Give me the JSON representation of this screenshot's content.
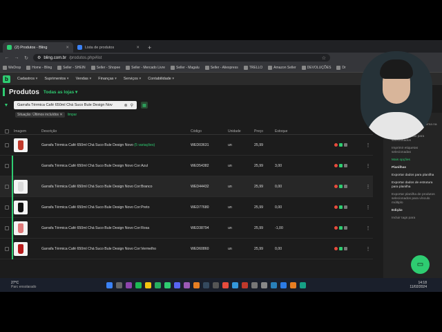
{
  "browser": {
    "tabs": [
      {
        "label": "(2) Produtos - Bling",
        "active": true
      },
      {
        "label": "Lista de produtos",
        "active": false
      }
    ],
    "url_host": "bling.com.br",
    "url_path": "/produtos.php#list",
    "bookmarks": [
      "WeDrop",
      "Home - Bling",
      "Seller - SHEIN",
      "Seller - Shopee",
      "Seller - Mercado Livre",
      "Seller - Magalu",
      "Seller - Aliexpress",
      "TRELLO",
      "Amazon Seller",
      "DEVOLUÇÕES",
      "Dr"
    ]
  },
  "app": {
    "logo": "b",
    "menu": [
      "Cadastros",
      "Suprimentos",
      "Vendas",
      "Finanças",
      "Serviços",
      "Contabilidade"
    ],
    "page_title": "Produtos",
    "store_select": "Todas as lojas ▾",
    "search_value": "Garrafa Térmica Café 650ml Chá Suco Bule Design Nov",
    "filter_chip": "Situação: Últimos incluídos ✕",
    "clear_label": "limpar"
  },
  "table": {
    "headers": {
      "image": "Imagem",
      "description": "Descrição",
      "code": "Código",
      "unit": "Unidade",
      "price": "Preço",
      "stock": "Estoque"
    },
    "rows": [
      {
        "desc": "Garrafa Térmica Café 650ml Chá Suco Bule Design Novo",
        "var": "(5 variações)",
        "code": "WED03631",
        "unit": "un",
        "price": "25,99",
        "stock": "",
        "color": "#c0392b",
        "thumb": true,
        "line": false
      },
      {
        "desc": "Garrafa Térmica Café 650ml Chá Suco Bule Design Novo Cor:Azul",
        "var": "",
        "code": "WED54382",
        "unit": "un",
        "price": "25,99",
        "stock": "3,00",
        "color": "#2c3e50",
        "thumb": false,
        "line": true
      },
      {
        "desc": "Garrafa Térmica Café 650ml Chá Suco Bule Design Novo Cor:Branco",
        "var": "",
        "code": "WED44432",
        "unit": "un",
        "price": "25,99",
        "stock": "0,00",
        "color": "#dcdcdc",
        "thumb": true,
        "line": true
      },
      {
        "desc": "Garrafa Térmica Café 650ml Chá Suco Bule Design Novo Cor:Preto",
        "var": "",
        "code": "WED77680",
        "unit": "un",
        "price": "25,99",
        "stock": "0,00",
        "color": "#111111",
        "thumb": true,
        "line": true
      },
      {
        "desc": "Garrafa Térmica Café 650ml Chá Suco Bule Design Novo Cor:Rosa",
        "var": "",
        "code": "WED38794",
        "unit": "un",
        "price": "25,99",
        "stock": "-1,00",
        "color": "#e07a7a",
        "thumb": true,
        "line": true
      },
      {
        "desc": "Garrafa Térmica Café 650ml Chá Suco Bule Design Novo Cor:Vermelho",
        "var": "",
        "code": "WED60860",
        "unit": "un",
        "price": "25,99",
        "stock": "0,00",
        "color": "#b71c1c",
        "thumb": true,
        "line": true
      }
    ]
  },
  "sidebar": {
    "items": [
      {
        "text": "...ar preços de ... virtual",
        "cls": ""
      },
      {
        "text": "...mportar preços do ...tema na loja virtual",
        "cls": ""
      },
      {
        "text": "Incluir categorias para selecionados",
        "cls": ""
      },
      {
        "text": "Imprimir etiquetas selecionadas",
        "cls": ""
      },
      {
        "text": "Mais opções",
        "cls": "sect"
      },
      {
        "text": "Planilhas",
        "cls": "h"
      },
      {
        "text": "Exportar dados para planilha",
        "cls": "on"
      },
      {
        "text": "Exportar dados de estrutura para planilha",
        "cls": "on"
      },
      {
        "text": "Exportar planilha de produtos selecionados para vínculo múltiplo",
        "cls": ""
      },
      {
        "text": "Edição",
        "cls": "h"
      },
      {
        "text": "Incluir tags para",
        "cls": ""
      }
    ]
  },
  "taskbar": {
    "temp": "27°C",
    "weather": "Parc ensolarado",
    "time": "14:18",
    "date": "11/02/2024"
  },
  "colors": {
    "accent": "#2ecc71",
    "bg": "#1c1c1c"
  }
}
